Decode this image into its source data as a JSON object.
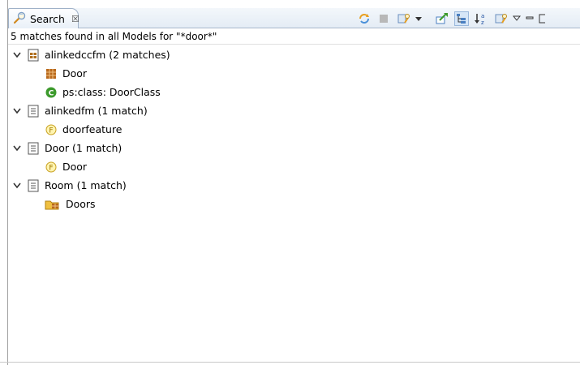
{
  "tab": {
    "label": "Search",
    "close": "☒"
  },
  "toolbar": {
    "items": [
      "refresh-search-icon",
      "cancel-search-icon",
      "search-history-icon",
      "dropdown-arrow-icon",
      "export-results-icon",
      "tree-layout-icon",
      "sort-alphabetical-icon",
      "filter-icon",
      "view-menu-icon",
      "minimize-icon",
      "maximize-icon"
    ],
    "colors": {
      "accent": "#4a90d9",
      "stop": "#b0b0b0",
      "orange": "#e8a020",
      "green": "#3c9a2c"
    }
  },
  "status": {
    "text": "5 matches found in all Models for \"*door*\""
  },
  "tree": {
    "nodes": [
      {
        "label": "alinkedccfm (2 matches)",
        "icon": "model-icon",
        "level": 0,
        "expanded": true
      },
      {
        "label": "Door",
        "icon": "component-icon",
        "level": 1
      },
      {
        "label": "ps:class: DoorClass",
        "icon": "class-icon",
        "level": 1
      },
      {
        "label": "alinkedfm (1 match)",
        "icon": "model-icon",
        "level": 0,
        "expanded": true
      },
      {
        "label": "doorfeature",
        "icon": "feature-icon",
        "level": 1
      },
      {
        "label": "Door (1 match)",
        "icon": "model-icon",
        "level": 0,
        "expanded": true
      },
      {
        "label": "Door",
        "icon": "feature-icon",
        "level": 1
      },
      {
        "label": "Room (1 match)",
        "icon": "model-icon",
        "level": 0,
        "expanded": true
      },
      {
        "label": "Doors",
        "icon": "folder-icon",
        "level": 1
      }
    ]
  }
}
